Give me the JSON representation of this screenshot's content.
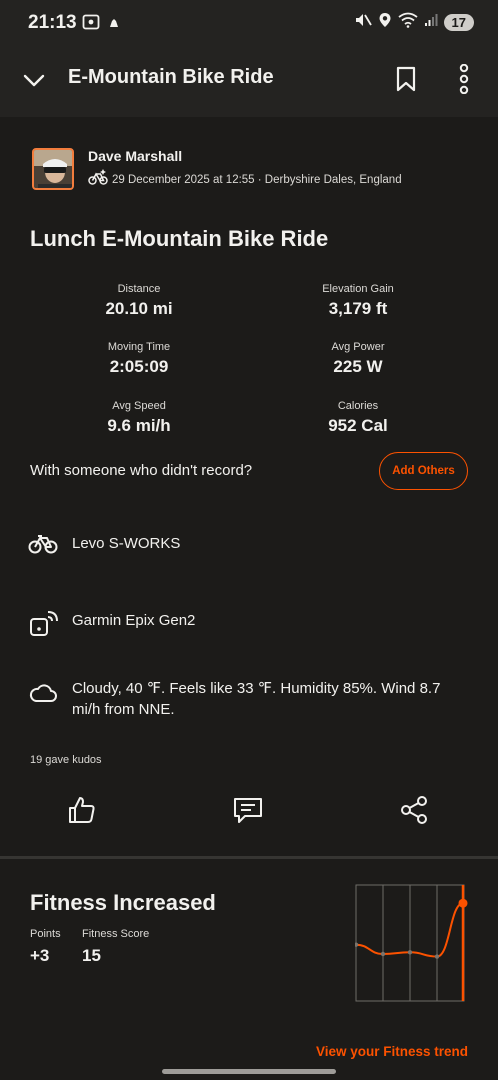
{
  "status_bar": {
    "time": "21:13",
    "battery": "17"
  },
  "app_bar": {
    "title": "E-Mountain Bike Ride"
  },
  "activity": {
    "athlete_name": "Dave Marshall",
    "meta": "29 December 2025 at 12:55 · Derbyshire Dales, England",
    "title": "Lunch E-Mountain Bike Ride",
    "stats": [
      {
        "label": "Distance",
        "value": "20.10 mi"
      },
      {
        "label": "Elevation Gain",
        "value": "3,179 ft"
      },
      {
        "label": "Moving Time",
        "value": "2:05:09"
      },
      {
        "label": "Avg Power",
        "value": "225 W"
      },
      {
        "label": "Avg Speed",
        "value": "9.6 mi/h"
      },
      {
        "label": "Calories",
        "value": "952 Cal"
      }
    ],
    "with_someone_prompt": "With someone who didn't record?",
    "add_others_label": "Add Others",
    "bike": "Levo S-WORKS",
    "device": "Garmin Epix Gen2",
    "weather": "Cloudy, 40 ℉. Feels like 33 ℉. Humidity 85%. Wind 8.7 mi/h from NNE.",
    "kudos": "19 gave kudos"
  },
  "icons": {
    "collapse": "chevron-down-icon",
    "bookmark": "bookmark-icon",
    "more": "more-vertical-icon",
    "sport": "e-bike-sparkle-icon",
    "bike": "bicycle-icon",
    "device": "watch-signal-icon",
    "weather": "cloud-icon",
    "kudos": "thumbs-up-icon",
    "comment": "comment-icon",
    "share": "share-icon"
  },
  "fitness": {
    "title": "Fitness Increased",
    "points_label": "Points",
    "points_value": "+3",
    "score_label": "Fitness Score",
    "score_value": "15",
    "link_label": "View your Fitness trend",
    "trend": [
      16.3,
      15.2,
      15.4,
      14.9,
      21.2
    ]
  },
  "colors": {
    "accent": "#fc5200",
    "background": "#1c1b19",
    "app_bar": "#242321",
    "text": "#f2f1ee"
  }
}
